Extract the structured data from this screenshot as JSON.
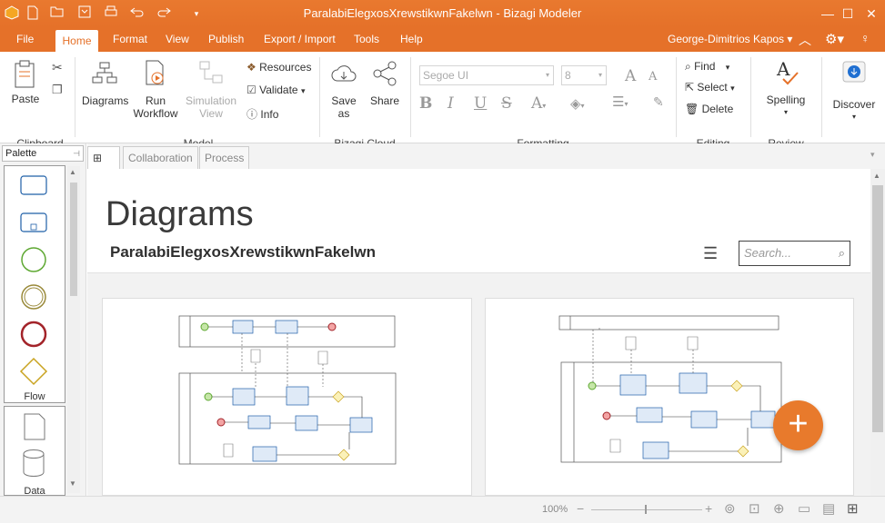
{
  "window": {
    "title": "ParalabiElegxosXrewstikwnFakelwn - Bizagi Modeler"
  },
  "menu": {
    "file": "File",
    "home": "Home",
    "format": "Format",
    "view": "View",
    "publish": "Publish",
    "export_import": "Export / Import",
    "tools": "Tools",
    "help": "Help",
    "user": "George-Dimitrios Kapos"
  },
  "ribbon": {
    "clipboard": {
      "paste": "Paste",
      "group": "Clipboard"
    },
    "model": {
      "diagrams": "Diagrams",
      "run_workflow_1": "Run",
      "run_workflow_2": "Workflow",
      "simulation_1": "Simulation",
      "simulation_2": "View",
      "resources": "Resources",
      "validate": "Validate",
      "info": "Info",
      "group": "Model"
    },
    "cloud": {
      "save_as": "Save as",
      "share": "Share",
      "group": "Bizagi Cloud"
    },
    "formatting": {
      "font": "Segoe UI",
      "size": "8",
      "group": "Formatting"
    },
    "editing": {
      "find": "Find",
      "select": "Select",
      "delete": "Delete",
      "group": "Editing"
    },
    "review": {
      "spelling": "Spelling",
      "group": "Review"
    },
    "discover": {
      "label": "Discover"
    }
  },
  "palette": {
    "title": "Palette",
    "flow_label": "Flow",
    "data_label": "Data"
  },
  "tabs": {
    "collaboration": "Collaboration",
    "process": "Process"
  },
  "main": {
    "title": "Diagrams",
    "project_name": "ParalabiElegxosXrewstikwnFakelwn",
    "search_placeholder": "Search..."
  },
  "status": {
    "zoom": "100%"
  },
  "colors": {
    "accent": "#e57129"
  }
}
